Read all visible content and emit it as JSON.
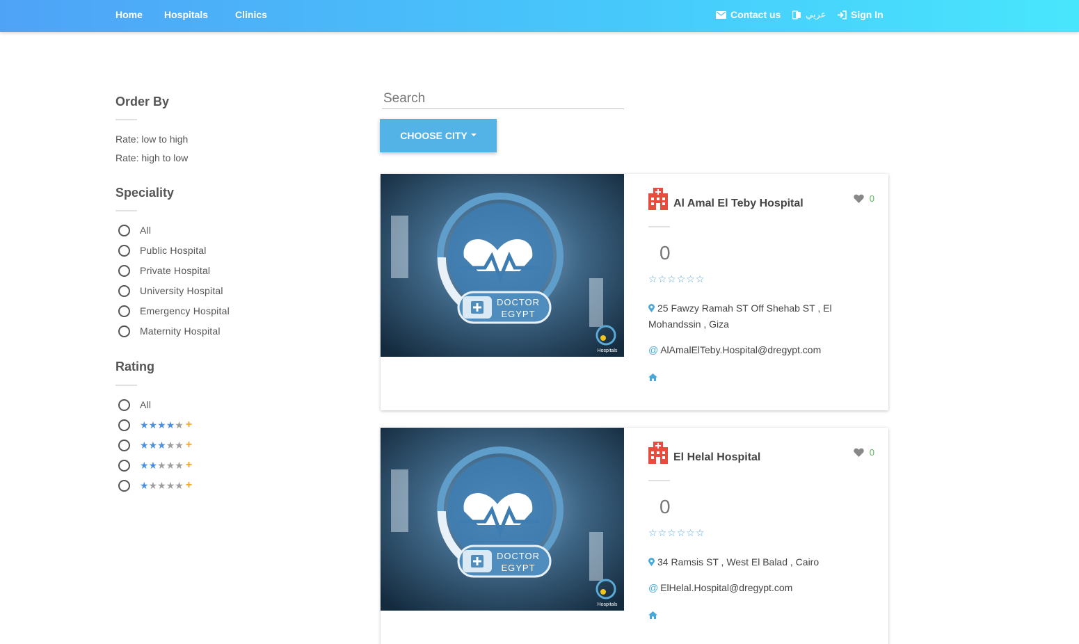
{
  "nav": {
    "home": "Home",
    "hospitals": "Hospitals",
    "clinics": "Clinics",
    "contact": "Contact us",
    "arabic": "عربي",
    "signin": "Sign In"
  },
  "sidebar": {
    "order_heading": "Order By",
    "order_options": [
      "Rate: low to high",
      "Rate: high to low"
    ],
    "speciality_heading": "Speciality",
    "speciality_options": [
      "All",
      "Public Hospital",
      "Private Hospital",
      "University Hospital",
      "Emergency Hospital",
      "Maternity Hospital"
    ],
    "rating_heading": "Rating",
    "rating_all": "All",
    "rating_filters": [
      4,
      3,
      2,
      1
    ]
  },
  "search": {
    "placeholder": "Search"
  },
  "city_button": "CHOOSE CITY",
  "hospitals": [
    {
      "name": "Al Amal El Teby Hospital",
      "favorites": "0",
      "rating": "0",
      "address": "25 Fawzy Ramah ST Off Shehab ST , El Mohandssin , Giza",
      "email": "AlAmalElTeby.Hospital@dregypt.com",
      "image_text": [
        "DOCTOR",
        "EGYPT",
        "Hospitals"
      ]
    },
    {
      "name": "El Helal Hospital",
      "favorites": "0",
      "rating": "0",
      "address": "34 Ramsis ST , West El Balad , Cairo",
      "email": "ElHelal.Hospital@dregypt.com",
      "image_text": [
        "DOCTOR",
        "EGYPT",
        "Hospitals"
      ]
    }
  ],
  "colors": {
    "nav_gradient_start": "#4fa3f7",
    "nav_gradient_end": "#48e6fd",
    "button": "#53b2e6",
    "hospital_icon": "#e84c3d",
    "fav_count": "#5cb85c",
    "star_on": "#4a90e2",
    "plus": "#f5a623"
  }
}
